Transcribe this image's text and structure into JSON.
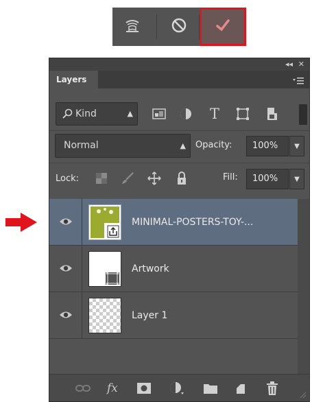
{
  "transform_bar": {
    "warp_icon": "warp-mode-icon",
    "cancel_icon": "cancel-transform-icon",
    "commit_icon": "commit-checkmark-icon",
    "commit_highlight_color": "#e0141c"
  },
  "pointer": {
    "icon": "red-arrow-pointer",
    "color": "#e0141c"
  },
  "panel": {
    "collapse_label": "◂◂",
    "close_label": "✕",
    "tab_label": "Layers",
    "menu_icon": "panel-menu-icon"
  },
  "filter": {
    "kind_label": "Kind",
    "kind_icon": "search-icon",
    "icons": [
      "image-filter-icon",
      "adjustment-filter-icon",
      "type-filter-icon",
      "shape-filter-icon",
      "smart-object-filter-icon"
    ]
  },
  "blend": {
    "mode": "Normal",
    "opacity_label": "Opacity:",
    "opacity_value": "100%"
  },
  "lock": {
    "label": "Lock:",
    "icons": [
      "lock-transparent-icon",
      "lock-image-icon",
      "lock-position-icon",
      "lock-all-icon"
    ],
    "fill_label": "Fill:",
    "fill_value": "100%"
  },
  "layers": [
    {
      "name": "MINIMAL-POSTERS-TOY-...",
      "selected": true,
      "type": "smart-object",
      "visible": true
    },
    {
      "name": "Artwork",
      "selected": false,
      "type": "shape",
      "visible": true
    },
    {
      "name": "Layer 1",
      "selected": false,
      "type": "transparent",
      "visible": true
    }
  ],
  "bottom_icons": [
    "link-layers-icon",
    "fx-icon",
    "add-mask-icon",
    "new-adjustment-icon",
    "new-group-icon",
    "new-layer-icon",
    "delete-layer-icon"
  ],
  "bottom_fx_label": "fx"
}
